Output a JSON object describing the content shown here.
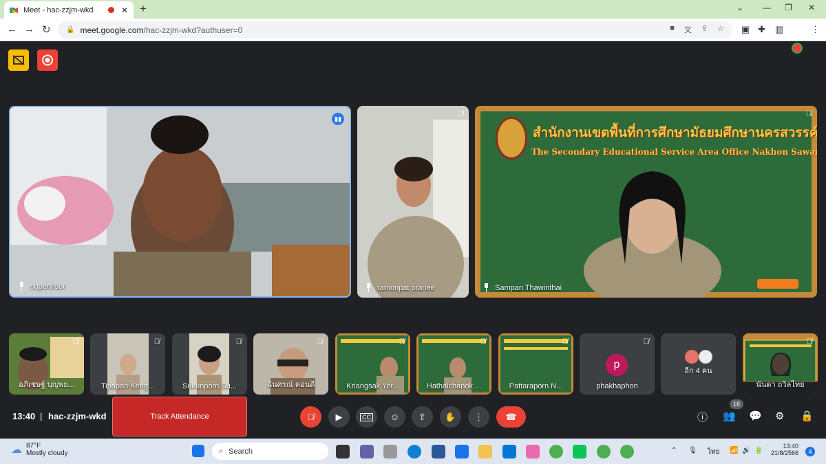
{
  "tab": {
    "title": "Meet - hac-zzjm-wkd"
  },
  "address": {
    "host": "meet.google.com",
    "path": "/hac-zzjm-wkd?authuser=0"
  },
  "tiles": {
    "main": [
      {
        "name": "supervisor"
      },
      {
        "name": "ramonpat pranee"
      },
      {
        "name": "Sampan Thawinthai"
      }
    ],
    "banner": {
      "thai": "สำนักงานเขตพื้นที่การศึกษามัธยมศึกษานครสวรรค์",
      "eng": "The Secondary Educational Service Area Office Nakhon Sawan"
    },
    "strip": [
      {
        "name": "อภิเชษฐ์ บุญพย..."
      },
      {
        "name": "Tipapan Keng..."
      },
      {
        "name": "Sukunporn Su..."
      },
      {
        "name": "ฉันศรณ์ คอนดี"
      },
      {
        "name": "Kriangsak Yor..."
      },
      {
        "name": "Hathaichanok ..."
      },
      {
        "name": "Pattaraporn N..."
      },
      {
        "name": "phakhaphon",
        "avatar": "p"
      },
      {
        "name": "อีก 4 คน"
      },
      {
        "name": "นันดา ถวิลไทย"
      }
    ]
  },
  "bottom": {
    "time": "13:40",
    "code": "hac-zzjm-wkd",
    "track": "Track Attendance",
    "participants": "16"
  },
  "taskbar": {
    "temp": "87°F",
    "weather": "Mostly cloudy",
    "search": "Search",
    "lang": "ไทย",
    "time": "13:40",
    "date": "21/8/2566",
    "notif": "4"
  },
  "colors": {
    "accent": "#8ab4f8",
    "end": "#ea4335",
    "track": "#c62828"
  }
}
